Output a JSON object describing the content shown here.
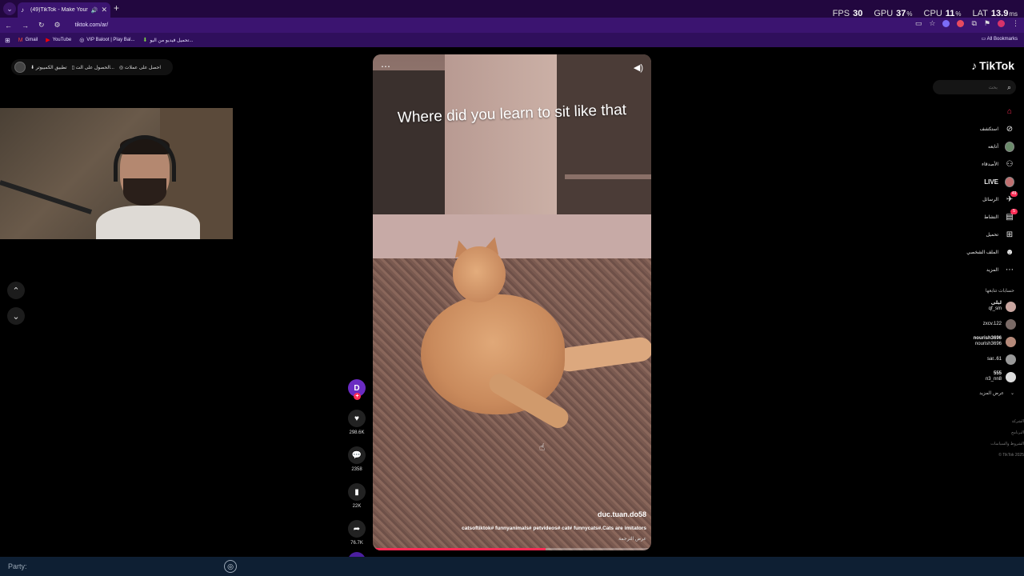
{
  "browser": {
    "tab_title": "(49)TikTok - Make Your Day",
    "url": "tiktok.com/ar/",
    "bookmarks": [
      {
        "label": "Gmail",
        "icon": "gmail-icon"
      },
      {
        "label": "YouTube",
        "icon": "youtube-icon"
      },
      {
        "label": "VIP Baloot | Play Bal...",
        "icon": "baloot-icon"
      },
      {
        "label": "تحميل فيديو من اليو...",
        "icon": "download-icon"
      }
    ],
    "all_bookmarks": "All Bookmarks"
  },
  "overlay": {
    "fps_label": "FPS",
    "fps": "30",
    "gpu_label": "GPU",
    "gpu": "37",
    "gpu_unit": "%",
    "cpu_label": "CPU",
    "cpu": "11",
    "cpu_unit": "%",
    "lat_label": "LAT",
    "lat": "13.9",
    "lat_unit": "ms"
  },
  "tiktok_topbar": {
    "coins": "احصل على عملات",
    "get_app": "الحصول على الت...",
    "desktop_app": "تطبيق الكمبيوتر"
  },
  "video": {
    "caption": "Where did you learn to sit like that",
    "author": "duc.tuan.do58",
    "description": "catsoftiktok# funnyanimals# petvideos# cat# funnycats#.Cats are imitators",
    "translate": "عرض الترجمة",
    "progress": 0.62
  },
  "actions": {
    "avatar_letter": "D",
    "likes": "298.6K",
    "comments": "2358",
    "saves": "22K",
    "shares": "76.7K",
    "sound_avatar_letter": "D"
  },
  "sidebar": {
    "logo": "TikTok",
    "search_placeholder": "بحث",
    "menu": [
      {
        "label": "",
        "icon": "home-icon",
        "active": true
      },
      {
        "label": "استكشف",
        "icon": "compass-icon"
      },
      {
        "label": "أتابعه",
        "icon": "following-avatar-icon"
      },
      {
        "label": "الأصدقاء",
        "icon": "friends-icon"
      },
      {
        "label": "LIVE",
        "icon": "live-icon"
      },
      {
        "label": "الرسائل",
        "icon": "messages-icon",
        "badge": "49"
      },
      {
        "label": "النشاط",
        "icon": "activity-icon",
        "badge": "5"
      },
      {
        "label": "تحميل",
        "icon": "upload-icon"
      },
      {
        "label": "الملف الشخصي",
        "icon": "profile-icon"
      },
      {
        "label": "المزيد",
        "icon": "more-icon"
      }
    ],
    "following_title": "حسابات تتابعها",
    "following": [
      {
        "name": "ليلى",
        "handle": "qf_sm",
        "color": "#c9a6a0"
      },
      {
        "name": "",
        "handle": "zxcv.122",
        "color": "#7a6a66"
      },
      {
        "name": "nourish3696",
        "handle": "nourish3696",
        "color": "#b58a7a"
      },
      {
        "name": "",
        "handle": "sar..61",
        "color": "#999999"
      },
      {
        "name": "555",
        "handle": "n3_nn8",
        "color": "#dddddd"
      }
    ],
    "see_more": "عرض المزيد",
    "footer": [
      "الشركة",
      "البرنامج",
      "الشروط والسياسات",
      "© TikTok 2025"
    ]
  },
  "party": {
    "label": "Party:"
  }
}
